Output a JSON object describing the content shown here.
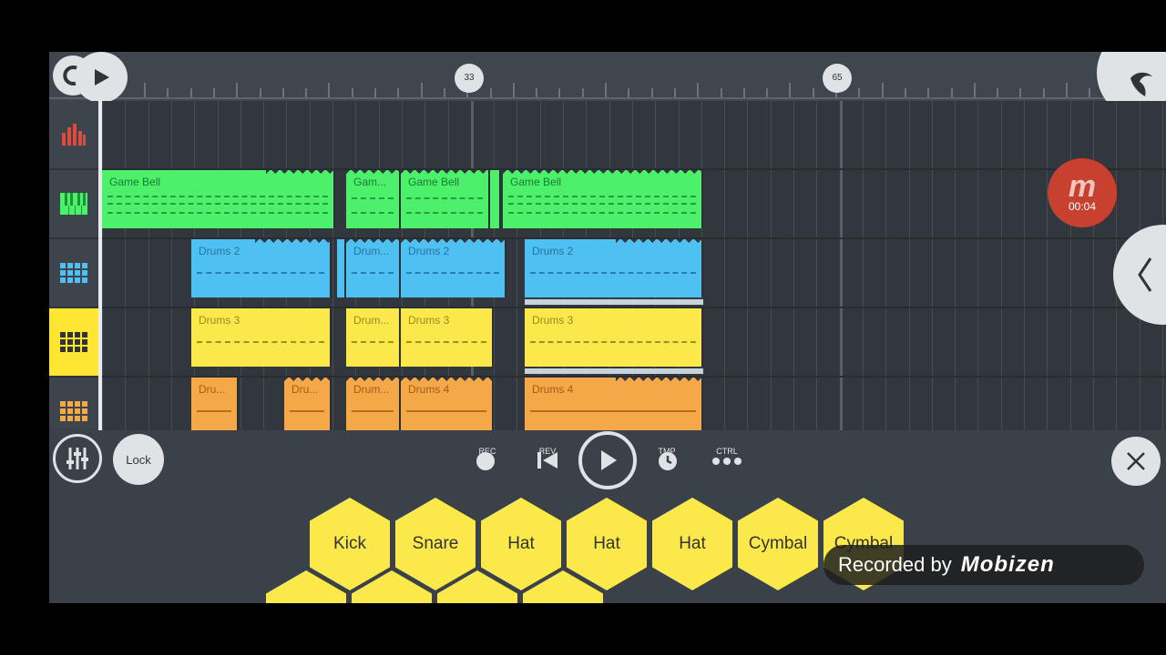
{
  "timeline": {
    "markers": [
      "33",
      "65"
    ]
  },
  "sidebar": {
    "tracks": [
      "mixer",
      "piano",
      "blue-drums",
      "yellow-drums",
      "orange-drums"
    ]
  },
  "tracks": [
    {
      "clips": [
        {
          "label": "Game Bell"
        },
        {
          "label": "Gam..."
        },
        {
          "label": "Game Bell"
        },
        {
          "label": ""
        },
        {
          "label": "Game Bell"
        }
      ]
    },
    {
      "clips": [
        {
          "label": "Drums 2"
        },
        {
          "label": ""
        },
        {
          "label": "Drum..."
        },
        {
          "label": "Drums 2"
        },
        {
          "label": "Drums 2"
        }
      ]
    },
    {
      "clips": [
        {
          "label": "Drums 3"
        },
        {
          "label": "Drum..."
        },
        {
          "label": "Drums 3"
        },
        {
          "label": "Drums 3"
        }
      ]
    },
    {
      "clips": [
        {
          "label": "Dru..."
        },
        {
          "label": "Dru..."
        },
        {
          "label": "Drum..."
        },
        {
          "label": "Drums 4"
        },
        {
          "label": "Drums 4"
        }
      ]
    }
  ],
  "recorder": {
    "time": "00:04",
    "text": "Recorded by",
    "brand": "Mobizen"
  },
  "controls": {
    "lock_label": "Lock",
    "rec_label": "REC",
    "rev_label": "REV",
    "tmp_label": "TMP",
    "ctrl_label": "CTRL"
  },
  "pads": [
    "Kick",
    "Snare",
    "Hat",
    "Hat",
    "Hat",
    "Cymbal",
    "Cymbal"
  ],
  "colors": {
    "green": "#4cf06a",
    "blue": "#4ec1f2",
    "yellow": "#fbe94c",
    "orange": "#f5a847",
    "record": "#c8402e"
  }
}
